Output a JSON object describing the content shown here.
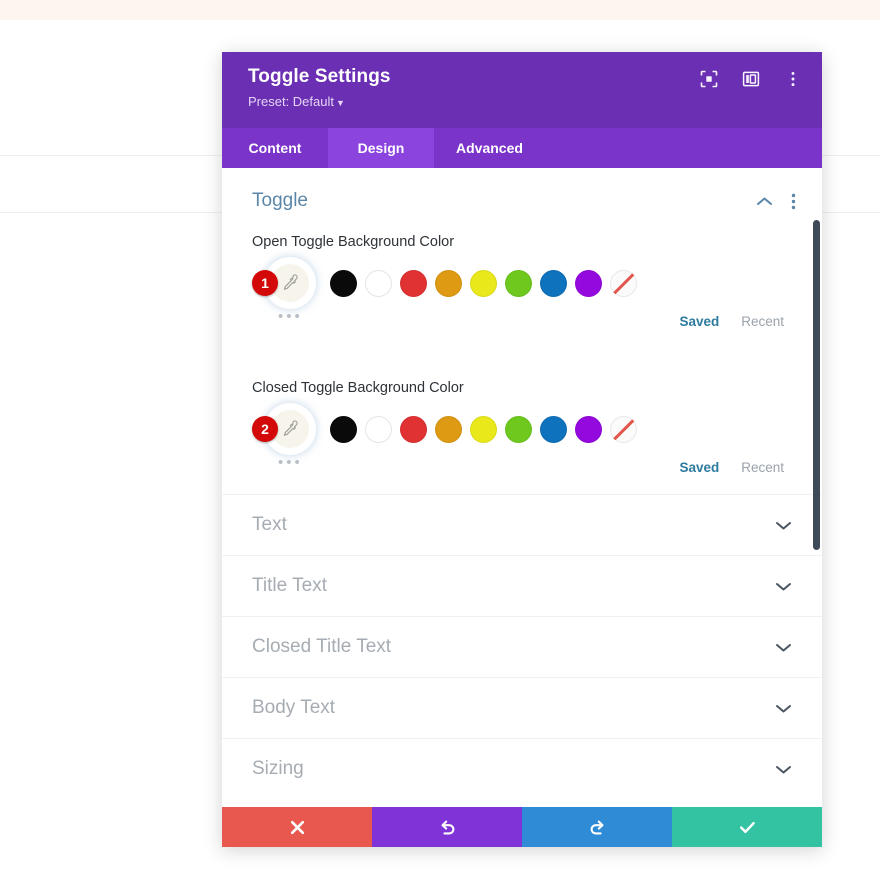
{
  "window": {
    "title": "Toggle Settings",
    "preset_label": "Preset: Default",
    "header_icons": [
      {
        "name": "focus-icon"
      },
      {
        "name": "layout-panel-icon"
      },
      {
        "name": "kebab-menu-icon"
      }
    ]
  },
  "tabs": [
    {
      "label": "Content",
      "active": false
    },
    {
      "label": "Design",
      "active": true
    },
    {
      "label": "Advanced",
      "active": false
    }
  ],
  "section": {
    "title": "Toggle",
    "collapse_icon": "chevron-up-icon",
    "options_icon": "kebab-menu-icon"
  },
  "color_fields": [
    {
      "label": "Open Toggle Background Color",
      "badge": "1",
      "picker_icon": "eyedropper-icon",
      "more_dots": "•••",
      "saved_label": "Saved",
      "recent_label": "Recent",
      "swatches": [
        {
          "name": "black",
          "hex": "#0a0a0a"
        },
        {
          "name": "white",
          "hex": "#ffffff"
        },
        {
          "name": "red",
          "hex": "#e03232"
        },
        {
          "name": "orange",
          "hex": "#dd9a12"
        },
        {
          "name": "yellow",
          "hex": "#e8e81a"
        },
        {
          "name": "green",
          "hex": "#6ec81e"
        },
        {
          "name": "blue",
          "hex": "#0f72bd"
        },
        {
          "name": "purple",
          "hex": "#9409dd"
        },
        {
          "name": "none",
          "hex": "#fbfbfb"
        }
      ]
    },
    {
      "label": "Closed Toggle Background Color",
      "badge": "2",
      "picker_icon": "eyedropper-icon",
      "more_dots": "•••",
      "saved_label": "Saved",
      "recent_label": "Recent",
      "swatches": [
        {
          "name": "black",
          "hex": "#0a0a0a"
        },
        {
          "name": "white",
          "hex": "#ffffff"
        },
        {
          "name": "red",
          "hex": "#e03232"
        },
        {
          "name": "orange",
          "hex": "#dd9a12"
        },
        {
          "name": "yellow",
          "hex": "#e8e81a"
        },
        {
          "name": "green",
          "hex": "#6ec81e"
        },
        {
          "name": "blue",
          "hex": "#0f72bd"
        },
        {
          "name": "purple",
          "hex": "#9409dd"
        },
        {
          "name": "none",
          "hex": "#fbfbfb"
        }
      ]
    }
  ],
  "accordion_sections": [
    {
      "label": "Text",
      "icon": "chevron-down-icon"
    },
    {
      "label": "Title Text",
      "icon": "chevron-down-icon"
    },
    {
      "label": "Closed Title Text",
      "icon": "chevron-down-icon"
    },
    {
      "label": "Body Text",
      "icon": "chevron-down-icon"
    },
    {
      "label": "Sizing",
      "icon": "chevron-down-icon"
    }
  ],
  "footer_buttons": [
    {
      "name": "cancel-button",
      "icon": "close-x-icon",
      "color": "#e8584f"
    },
    {
      "name": "undo-button",
      "icon": "undo-icon",
      "color": "#8033d6"
    },
    {
      "name": "redo-button",
      "icon": "redo-icon",
      "color": "#2f8bd6"
    },
    {
      "name": "save-button",
      "icon": "checkmark-icon",
      "color": "#33c2a2"
    }
  ],
  "theme": {
    "header_purple": "#6b2fb3",
    "tabbar_purple": "#7b34c9",
    "tab_active_purple": "#8c44de",
    "section_title_blue": "#5b86a8",
    "badge_red": "#d30808",
    "saved_teal": "#2d7b9e"
  }
}
